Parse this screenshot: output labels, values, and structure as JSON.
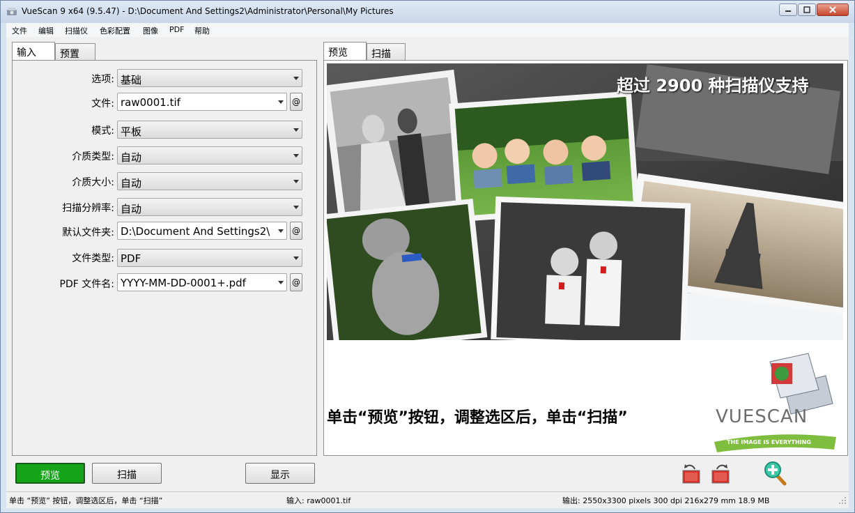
{
  "window": {
    "title": "VueScan 9 x64 (9.5.47)  -  D:\\Document And Settings2\\Administrator\\Personal\\My Pictures"
  },
  "menu": [
    "文件",
    "编辑",
    "扫描仪",
    "色彩配置",
    "图像",
    "PDF",
    "帮助"
  ],
  "left_tabs": [
    "输入",
    "预置"
  ],
  "fields": [
    {
      "label": "选项:",
      "value": "基础"
    },
    {
      "label": "文件:",
      "value": "raw0001.tif"
    },
    {
      "label": "模式:",
      "value": "平板"
    },
    {
      "label": "介质类型:",
      "value": "自动"
    },
    {
      "label": "介质大小:",
      "value": "自动"
    },
    {
      "label": "扫描分辨率:",
      "value": "自动"
    },
    {
      "label": "默认文件夹:",
      "value": "D:\\Document And Settings2\\"
    },
    {
      "label": "文件类型:",
      "value": "PDF"
    },
    {
      "label": "PDF 文件名:",
      "value": "YYYY-MM-DD-0001+.pdf"
    }
  ],
  "at_symbol": "@",
  "right_tabs": [
    "预览",
    "扫描"
  ],
  "preview": {
    "banner": "超过 2900 种扫描仪支持",
    "instruction": "单击“预览”按钮，调整选区后，单击“扫描”",
    "logo_text": "VueScan",
    "logo_tagline": "THE IMAGE IS EVERYTHING"
  },
  "buttons": {
    "preview": "预览",
    "scan": "扫描",
    "show": "显示"
  },
  "status": {
    "hint": "单击 “预览” 按钮，调整选区后，单击 “扫描”",
    "input": "输入: raw0001.tif",
    "output": "输出: 2550x3300 pixels 300 dpi 216x279 mm 18.9 MB"
  },
  "colors": {
    "preview_button": "#15a31a",
    "accent": "#d9e4f1"
  },
  "icons": [
    "rotate-left-icon",
    "rotate-right-icon",
    "zoom-in-icon"
  ]
}
